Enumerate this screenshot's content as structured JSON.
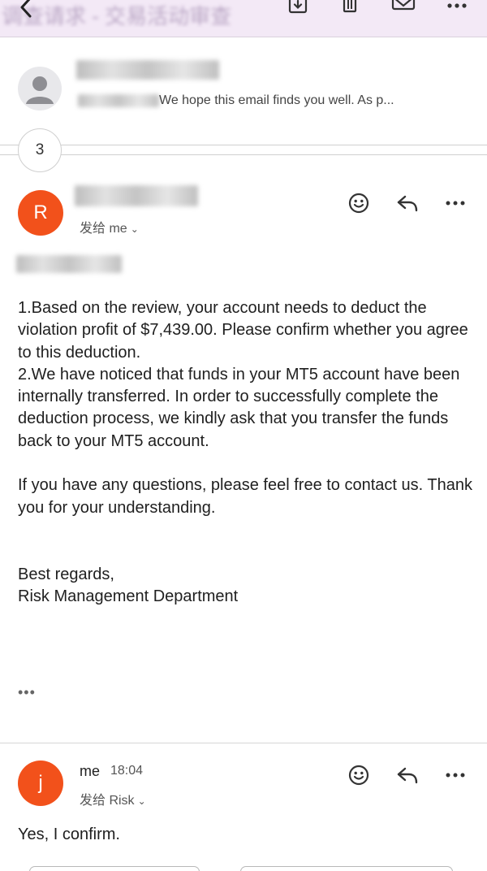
{
  "topbar": {
    "back_icon": "chevron-left-icon",
    "subject": "调查请求 - 交易活动审查",
    "icons": [
      "archive-download-icon",
      "trash-icon",
      "mail-icon",
      "more-horizontal-icon"
    ]
  },
  "thread": {
    "collapsed_message": {
      "snippet": "We hope this email finds you well. As p..."
    },
    "hidden_count": "3"
  },
  "message_risk": {
    "avatar_letter": "R",
    "avatar_color": "#f2511b",
    "to_label": "发给 me",
    "body": {
      "para1": "1.Based on the review, your account needs to deduct the violation profit of $7,439.00. Please confirm whether you agree to this deduction.",
      "para2": "2.We have noticed that funds in your MT5 account have been internally transferred. In order to successfully complete the deduction process, we kindly ask that you transfer the funds back to your MT5 account.",
      "para3": "If you have any questions, please feel free to contact us. Thank you for your understanding.",
      "closing": "Best regards,",
      "signature": "Risk Management Department"
    },
    "trimmed_content": "•••"
  },
  "message_me": {
    "avatar_letter": "j",
    "avatar_color": "#f2511b",
    "sender": "me",
    "time": "18:04",
    "to_label": "发给 Risk",
    "body": "Yes, I confirm."
  },
  "actions": {
    "emoji_icon": "emoji-smile-icon",
    "reply_icon": "reply-arrow-icon",
    "more_icon": "more-horizontal-icon"
  }
}
